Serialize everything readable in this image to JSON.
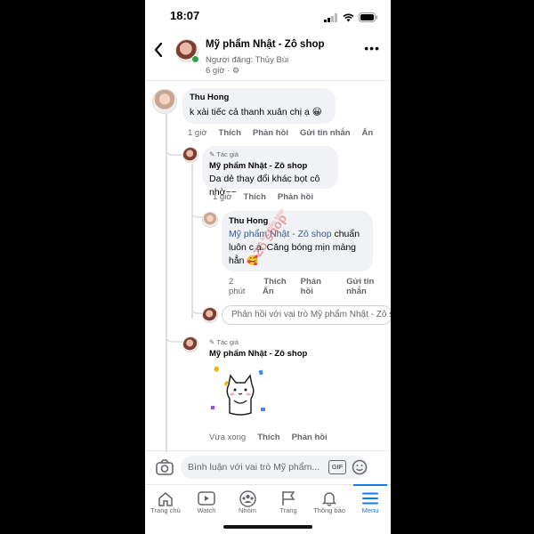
{
  "status_bar": {
    "time": "18:07"
  },
  "header": {
    "page_name": "Mỹ phẩm Nhật - Zô shop",
    "poster": "Người đăng: Thủy Bùi",
    "time": "6 giờ ·"
  },
  "comments": [
    {
      "author": "Thu Hong",
      "text": "k xài tiếc cả thanh xuân chị ạ 😀",
      "time": "1 giờ",
      "actions": [
        "Thích",
        "Phản hồi",
        "Gửi tin nhắn",
        "Ẩn"
      ]
    },
    {
      "badge": "Tác giả",
      "author": "Mỹ phẩm Nhật - Zô shop",
      "text": "Da dẻ thay đổi khác bọt cô nhờ~~",
      "time": "1 giờ",
      "actions": [
        "Thích",
        "Phản hồi"
      ]
    },
    {
      "author": "Thu Hong",
      "mention": "Mỹ phẩm Nhật - Zô shop",
      "text_after_mention": " chuẩn luôn c ạ. Căng bóng mịn màng hẳn 🥰",
      "time": "2 phút",
      "actions": [
        "Thích",
        "Phản hồi",
        "Gửi tin nhắn"
      ],
      "extra_action": "Ẩn"
    },
    {
      "badge": "Tác giả",
      "author": "Mỹ phẩm Nhật - Zô shop",
      "sticker": "cat-sticker",
      "time": "Vừa xong",
      "actions": [
        "Thích",
        "Phản hồi"
      ]
    }
  ],
  "reply_input": {
    "placeholder": "Phản hồi với vai trò Mỹ phẩm Nhật - Zô shop"
  },
  "comment_input": {
    "placeholder": "Bình luận với vai trò Mỹ phẩm..."
  },
  "watermark": "Zô shop",
  "watermark_small": "Mỹ phẩm Nhật",
  "nav": [
    {
      "label": "Trang chủ",
      "icon": "home-icon"
    },
    {
      "label": "Watch",
      "icon": "watch-icon"
    },
    {
      "label": "Nhóm",
      "icon": "groups-icon"
    },
    {
      "label": "Trang",
      "icon": "flag-icon"
    },
    {
      "label": "Thông báo",
      "icon": "bell-icon"
    },
    {
      "label": "Menu",
      "icon": "menu-icon",
      "active": true
    }
  ],
  "colors": {
    "accent": "#1877f2",
    "bubble": "#f0f2f5",
    "muted": "#65676b",
    "online": "#31a24c"
  }
}
